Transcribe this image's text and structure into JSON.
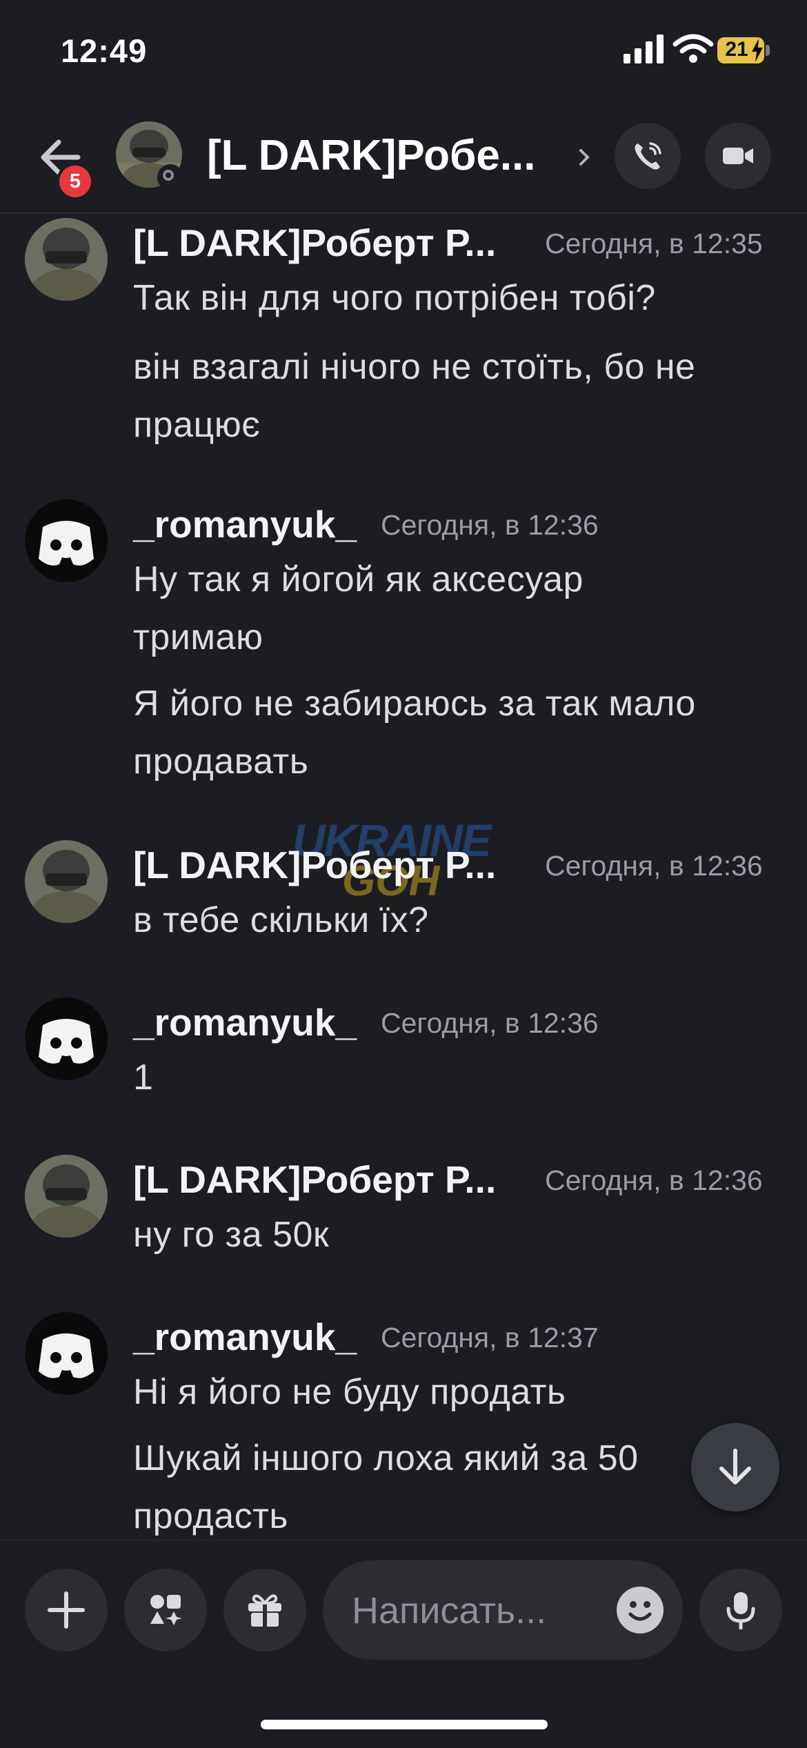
{
  "status_bar": {
    "time": "12:49",
    "battery": "21"
  },
  "header": {
    "title": "[L DARK]Робе...",
    "unread_count": "5"
  },
  "watermark": {
    "line1": "UKRAINE",
    "line2": "GOH"
  },
  "messages": [
    {
      "author": "[L DARK]Роберт Р...",
      "timestamp": "Сегодня, в 12:35",
      "lines": [
        "Так він для чого потрібен тобі?",
        "він взагалі нічого не стоїть, бо не",
        "працює"
      ]
    },
    {
      "author": "_romanyuk_",
      "timestamp": "Сегодня, в 12:36",
      "lines": [
        "Ну так я йогой як аксесуар",
        "тримаю",
        "Я його не забираюсь за так мало",
        "продавать"
      ]
    },
    {
      "author": "[L DARK]Роберт Р...",
      "timestamp": "Сегодня, в 12:36",
      "lines": [
        "в тебе скільки їх?"
      ]
    },
    {
      "author": "_romanyuk_",
      "timestamp": "Сегодня, в 12:36",
      "lines": [
        "1"
      ]
    },
    {
      "author": "[L DARK]Роберт Р...",
      "timestamp": "Сегодня, в 12:36",
      "lines": [
        "ну го за 50к"
      ]
    },
    {
      "author": "_romanyuk_",
      "timestamp": "Сегодня, в 12:37",
      "lines": [
        "Ні я його не буду продать",
        "Шукай іншого лоха який за 50",
        "продасть"
      ]
    }
  ],
  "composer": {
    "placeholder": "Написать..."
  },
  "colors": {
    "background": "#1c1d22",
    "badge": "#e5383f",
    "button": "#2b2d33"
  }
}
